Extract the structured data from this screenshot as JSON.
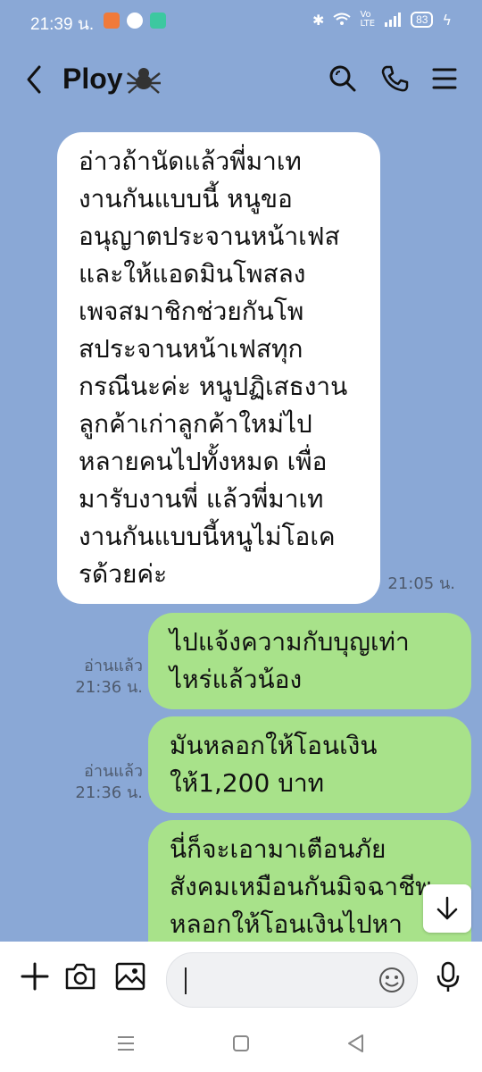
{
  "status": {
    "time": "21:39 น.",
    "battery": "83"
  },
  "header": {
    "contact_name": "Ploy"
  },
  "messages": [
    {
      "side": "left",
      "lines": [
        "อ่าวถ้านัดแล้วพี่มาเท",
        "งานกันแบบนี้ หนูขอ",
        "อนุญาตประจานหน้าเฟส",
        "และให้แอดมินโพสลง",
        "เพจสมาชิกช่วยกันโพ",
        "สประจานหน้าเฟสทุก",
        "กรณีนะค่ะ หนูปฏิเสธงาน",
        "ลูกค้าเก่าลูกค้าใหม่ไป",
        "หลายคนไปทั้งหมด เพื่อ",
        "มารับงานพี่ แล้วพี่มาเท",
        "งานกันแบบนี้หนูไม่โอเค",
        "รด้วยค่ะ"
      ],
      "time": "21:05 น."
    },
    {
      "side": "right",
      "lines": [
        "ไปแจ้งความกับบุญเท่า",
        "ไหร่แล้วน้อง"
      ],
      "read": "อ่านแล้ว",
      "time": "21:36 น."
    },
    {
      "side": "right",
      "lines": [
        "มันหลอกให้โอนเงิน",
        "ให้1,200 บาท"
      ],
      "read": "อ่านแล้ว",
      "time": "21:36 น."
    },
    {
      "side": "right",
      "lines": [
        "นี่ก็จะเอามาเตือนภัย",
        "สังคมเหมือนกันมิจฉาชีพ",
        "หลอกให้โอนเงินไปหา"
      ]
    }
  ],
  "colors": {
    "background": "#8aa8d6",
    "incoming_bubble": "#ffffff",
    "outgoing_bubble": "#a8e28a"
  },
  "icons": [
    "back-arrow-icon",
    "spider-emoji-icon",
    "search-icon",
    "phone-icon",
    "menu-icon",
    "plus-icon",
    "camera-icon",
    "image-icon",
    "emoji-icon",
    "microphone-icon",
    "scroll-down-icon",
    "nav-recents-icon",
    "nav-home-icon",
    "nav-back-icon"
  ]
}
